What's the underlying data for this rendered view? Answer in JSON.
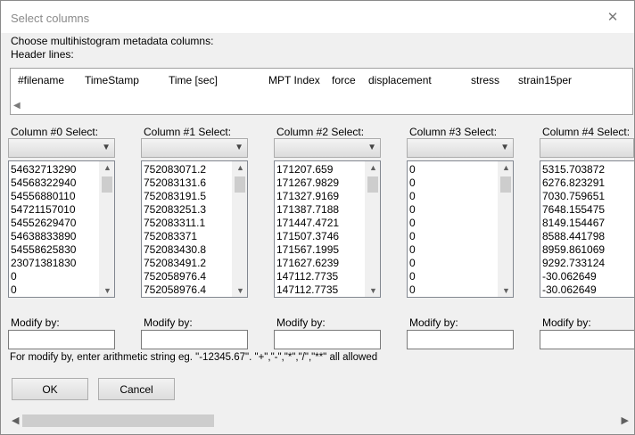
{
  "window": {
    "title": "Select columns",
    "close_glyph": "✕"
  },
  "labels": {
    "instruction": "Choose multihistogram metadata columns:",
    "header_lines": "Header lines:",
    "hint": "For modify by, enter arithmetic string eg. \"-12345.67\". \"+\",\"-\",\"*\",\"/\",\"**\" all allowed"
  },
  "header_line": {
    "columns": [
      "#filename",
      "TimeStamp",
      "Time [sec]",
      "MPT Index",
      "force",
      "displacement",
      "stress",
      "strain15per"
    ]
  },
  "columns": [
    {
      "label": "Column #0 Select:",
      "selected": "",
      "values": [
        "54632713290",
        "54568322940",
        "54556880110",
        "54721157010",
        "54552629470",
        "54638833890",
        "54558625830",
        "23071381830",
        "0",
        "0"
      ],
      "modify_label": "Modify by:",
      "modify_value": ""
    },
    {
      "label": "Column #1 Select:",
      "selected": "",
      "values": [
        "752083071.2",
        "752083131.6",
        "752083191.5",
        "752083251.3",
        "752083311.1",
        "752083371",
        "752083430.8",
        "752083491.2",
        "752058976.4",
        "752058976.4"
      ],
      "modify_label": "Modify by:",
      "modify_value": ""
    },
    {
      "label": "Column #2 Select:",
      "selected": "",
      "values": [
        "171207.659",
        "171267.9829",
        "171327.9169",
        "171387.7188",
        "171447.4721",
        "171507.3746",
        "171567.1995",
        "171627.6239",
        "147112.7735",
        "147112.7735"
      ],
      "modify_label": "Modify by:",
      "modify_value": ""
    },
    {
      "label": "Column #3 Select:",
      "selected": "",
      "values": [
        "0",
        "0",
        "0",
        "0",
        "0",
        "0",
        "0",
        "0",
        "0",
        "0"
      ],
      "modify_label": "Modify by:",
      "modify_value": ""
    },
    {
      "label": "Column #4 Select:",
      "selected": "",
      "values": [
        "5315.703872",
        "6276.823291",
        "7030.759651",
        "7648.155475",
        "8149.154467",
        "8588.441798",
        "8959.861069",
        "9292.733124",
        "-30.062649",
        "-30.062649"
      ],
      "modify_label": "Modify by:",
      "modify_value": ""
    }
  ],
  "buttons": {
    "ok": "OK",
    "cancel": "Cancel"
  },
  "icons": {
    "scroll_up": "▲",
    "scroll_down": "▼",
    "scroll_left": "◀",
    "scroll_right": "▶",
    "combo": "▼"
  }
}
